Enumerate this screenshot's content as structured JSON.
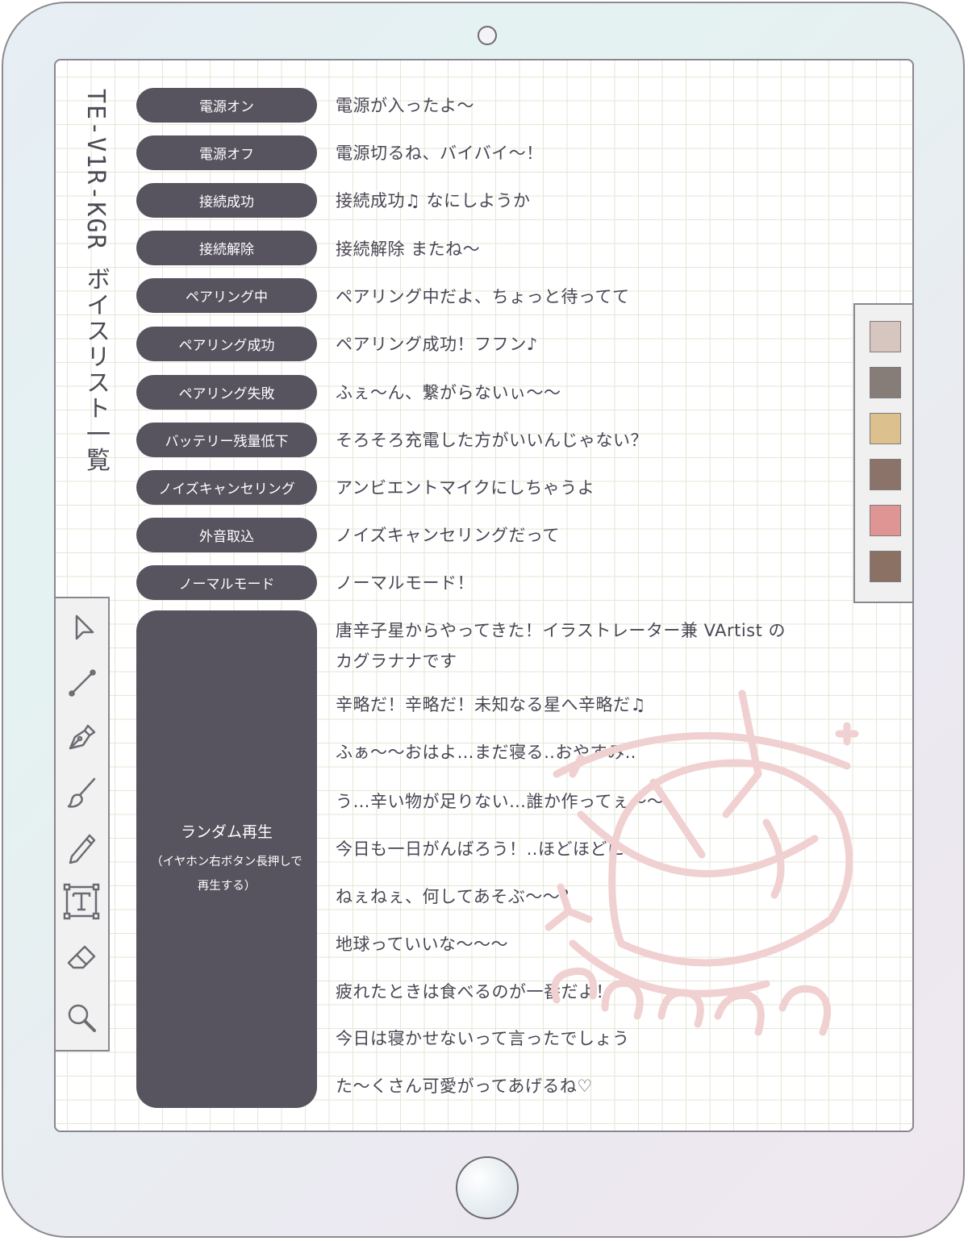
{
  "title": "TE-V1R-KGR ボイスリスト一覧",
  "commands": [
    {
      "label": "電源オン",
      "voice": "電源が入ったよ〜"
    },
    {
      "label": "電源オフ",
      "voice": "電源切るね、バイバイ〜！"
    },
    {
      "label": "接続成功",
      "voice": "接続成功♫ なにしようか"
    },
    {
      "label": "接続解除",
      "voice": "接続解除 またね〜"
    },
    {
      "label": "ペアリング中",
      "voice": "ペアリング中だよ、ちょっと待ってて"
    },
    {
      "label": "ペアリング成功",
      "voice": "ペアリング成功！フフン♪"
    },
    {
      "label": "ペアリング失敗",
      "voice": "ふぇ〜ん、繋がらないぃ〜〜"
    },
    {
      "label": "バッテリー残量低下",
      "voice": "そろそろ充電した方がいいんじゃない？"
    },
    {
      "label": "ノイズキャンセリング",
      "voice": "アンビエントマイクにしちゃうよ"
    },
    {
      "label": "外音取込",
      "voice": "ノイズキャンセリングだって"
    },
    {
      "label": "ノーマルモード",
      "voice": "ノーマルモード！"
    }
  ],
  "random": {
    "label": "ランダム再生",
    "note_line1": "（イヤホン右ボタン長押しで",
    "note_line2": "再生する）",
    "voices": [
      "唐辛子星からやってきた！イラストレーター兼 VArtist の\nカグラナナです",
      "辛略だ！辛略だ！未知なる星へ辛略だ♫",
      "ふぁ〜〜おはよ…まだ寝る‥おやすみ‥",
      "う…辛い物が足りない…誰か作ってぇ〜〜",
      "今日も一日がんばろう！‥ほどほどに‥",
      "ねぇねぇ、何してあそぶ〜〜？",
      "地球っていいな〜〜〜",
      "疲れたときは食べるのが一番だよ！",
      "今日は寝かせないって言ったでしょう",
      "た〜くさん可愛がってあげるね♡"
    ]
  },
  "palette": [
    "#d7c5bf",
    "#877d78",
    "#dcc08e",
    "#8b7369",
    "#df9593",
    "#8a7164"
  ],
  "tools": [
    "cursor-icon",
    "line-icon",
    "pen-nib-icon",
    "brush-icon",
    "pencil-icon",
    "text-icon",
    "eraser-icon",
    "magnifier-icon"
  ]
}
